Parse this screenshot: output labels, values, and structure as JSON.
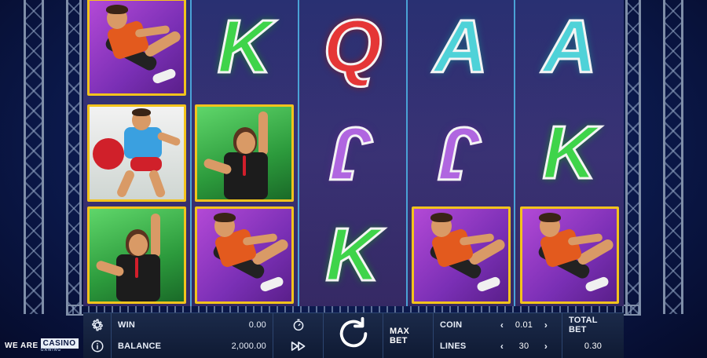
{
  "reels": [
    [
      "kicker",
      "raider",
      "referee"
    ],
    [
      "K",
      "referee",
      "kicker"
    ],
    [
      "Q",
      "J",
      "K"
    ],
    [
      "A",
      "J",
      "kicker"
    ],
    [
      "A",
      "K",
      "kicker"
    ]
  ],
  "symbol_colors": {
    "K": "#3fd44a",
    "Q": "#e53636",
    "A": "#4fd2d8",
    "J": "#b066e0",
    "frame": "#f3c31c"
  },
  "bar": {
    "win_label": "WIN",
    "win_value": "0.00",
    "balance_label": "BALANCE",
    "balance_value": "2,000.00",
    "max_bet_label": "MAX BET",
    "coin_label": "COIN",
    "coin_value": "0.01",
    "lines_label": "LINES",
    "lines_value": "30",
    "total_bet_label": "TOTAL BET",
    "total_bet_value": "0.30"
  },
  "icons": {
    "settings": "gear-icon",
    "info": "info-icon",
    "turbo": "stopwatch-icon",
    "autoplay": "fast-forward-icon",
    "spin": "spin-arrow-icon",
    "coin_prev": "chevron-left-icon",
    "coin_next": "chevron-right-icon",
    "lines_prev": "chevron-left-icon",
    "lines_next": "chevron-right-icon"
  },
  "logo": {
    "text": "WE ARE",
    "box_text": "CASINO",
    "tagline": "GAMING"
  }
}
